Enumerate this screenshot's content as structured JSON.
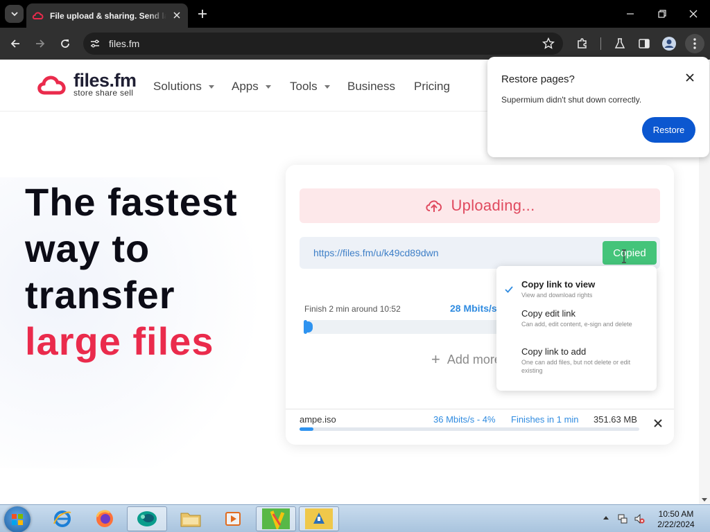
{
  "browser": {
    "tab_title": "File upload & sharing. Send large files",
    "url": "files.fm"
  },
  "site": {
    "logo_name": "files.fm",
    "logo_tagline": "store share sell",
    "nav": {
      "solutions": "Solutions",
      "apps": "Apps",
      "tools": "Tools",
      "business": "Business",
      "pricing": "Pricing"
    },
    "hero": {
      "line1": "The fastest",
      "line2": "way to",
      "line3": "transfer",
      "line4": "large files"
    }
  },
  "upload": {
    "status": "Uploading...",
    "link": "https://files.fm/u/k49cd89dwn",
    "copied_label": "Copied",
    "finish_text": "Finish 2 min around 10:52",
    "speed": "28 Mbits/s",
    "progress_fraction": 0.01,
    "add_more": "Add more",
    "file": {
      "name": "ampe.iso",
      "speed": "36 Mbits/s - 4%",
      "eta": "Finishes in 1 min",
      "size": "351.63 MB",
      "progress_fraction": 0.04
    }
  },
  "copy_menu": {
    "items": [
      {
        "title": "Copy link to view",
        "desc": "View and download rights"
      },
      {
        "title": "Copy edit link",
        "desc": "Can add, edit content, e-sign and delete"
      },
      {
        "title": "Copy link to add",
        "desc": "One can add files, but not delete or edit existing"
      }
    ]
  },
  "restore": {
    "title": "Restore pages?",
    "message": "Supermium didn't shut down correctly.",
    "button": "Restore"
  },
  "taskbar": {
    "time": "10:50 AM",
    "date": "2/22/2024"
  },
  "colors": {
    "accent_red": "#ea2b4c",
    "link_blue": "#3e7fc7",
    "progress_blue": "#2e93f0",
    "copied_green": "#44c47a",
    "restore_blue": "#0b57d0"
  }
}
